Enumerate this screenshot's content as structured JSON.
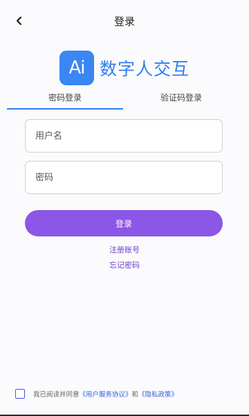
{
  "header": {
    "title": "登录",
    "back_icon": "chevron-left-icon"
  },
  "brand": {
    "logo_text": "Ai",
    "name": "数字人交互",
    "logo_color": "#3a86f3",
    "name_color": "#2f7ff0"
  },
  "tabs": [
    {
      "label": "密码登录",
      "active": true
    },
    {
      "label": "验证码登录",
      "active": false
    }
  ],
  "form": {
    "username_placeholder": "用户名",
    "username_value": "",
    "password_placeholder": "密码",
    "password_value": "",
    "submit_label": "登录",
    "submit_color": "#8c56e6"
  },
  "links": {
    "register": "注册账号",
    "forgot": "忘记密码"
  },
  "agreement": {
    "checked": false,
    "prefix": "我已阅读并同意",
    "terms": "《用户服务协议》",
    "and": "和",
    "privacy": "《隐私政策》"
  }
}
